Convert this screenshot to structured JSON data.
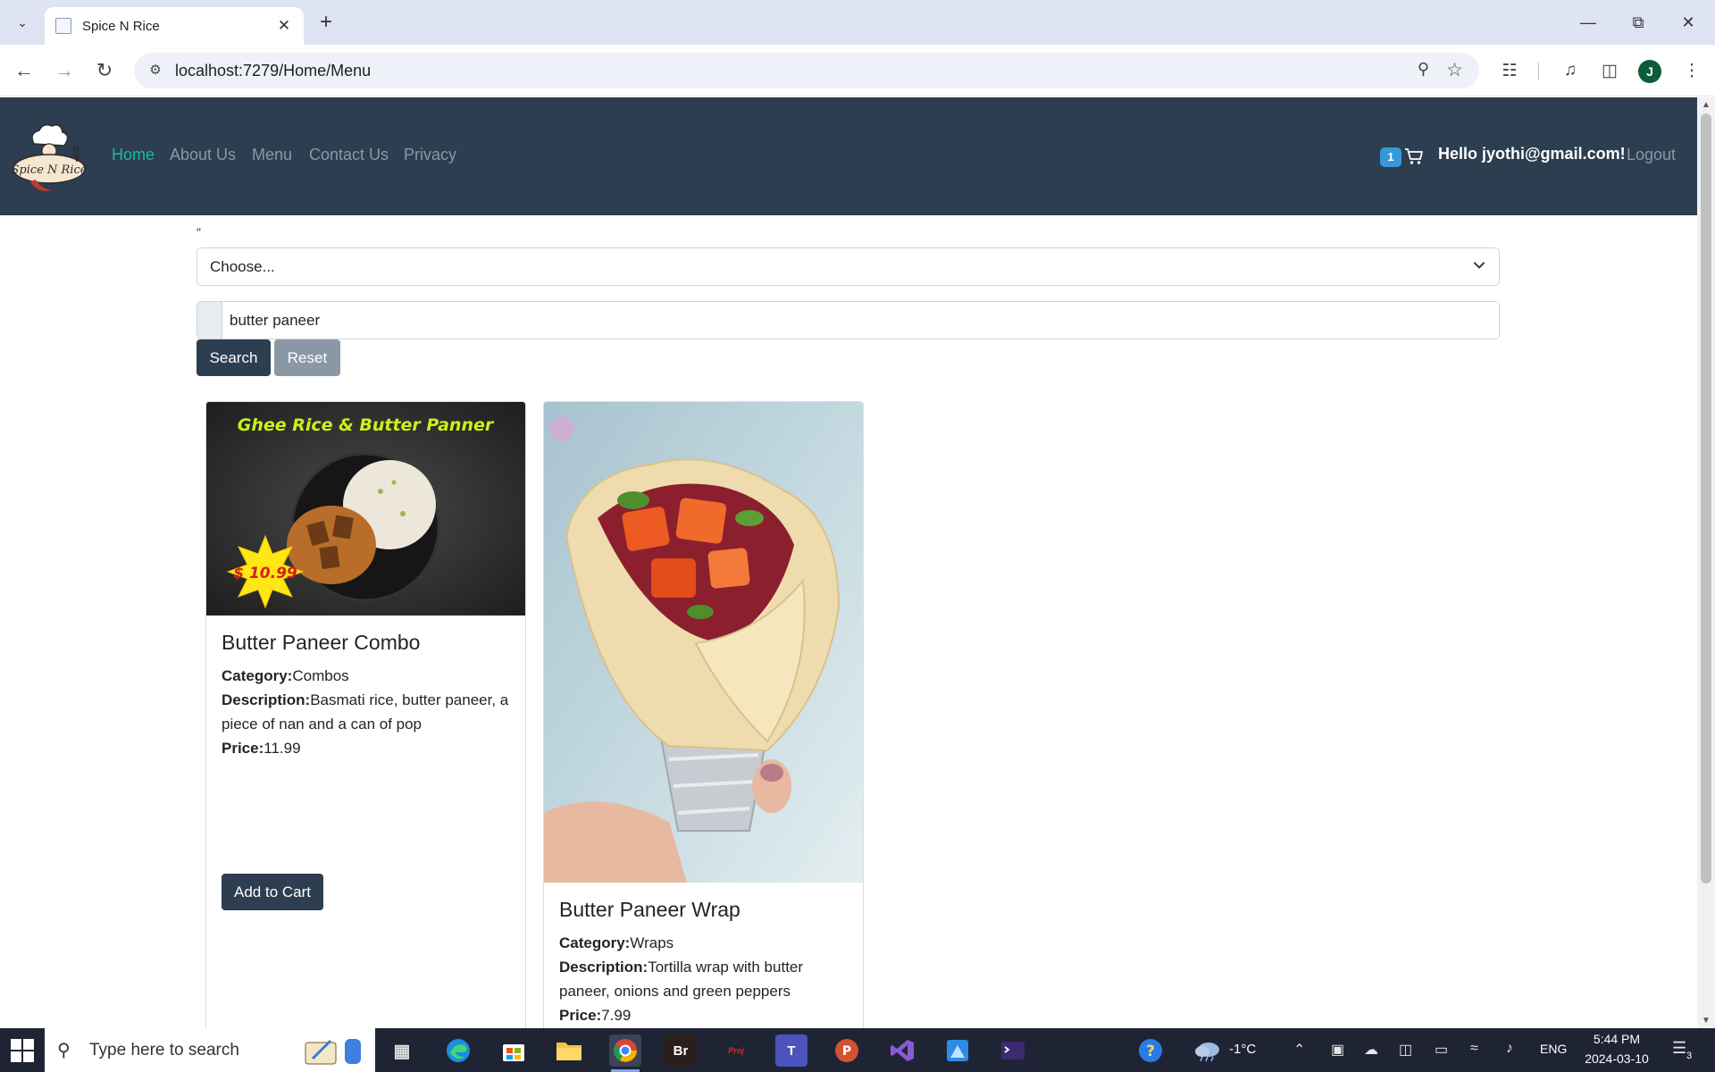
{
  "browser": {
    "tab_title": "Spice N Rice",
    "url": "localhost:7279/Home/Menu",
    "profile_initial": "J"
  },
  "site": {
    "logo_text": "Spice N Rice",
    "nav": [
      "Home",
      "About Us",
      "Menu",
      "Contact Us",
      "Privacy"
    ],
    "active_nav": "Home",
    "cart_count": "1",
    "greeting": "Hello jyothi@gmail.com!",
    "logout": "Logout",
    "colors": {
      "navbar": "#2c3e50",
      "active_link": "#18bc9c",
      "badge": "#3498db",
      "muted_link": "#8a98a8"
    }
  },
  "filter": {
    "stray_text": "\"",
    "category_select": "Choose...",
    "search_value": "butter paneer",
    "search_button": "Search",
    "reset_button": "Reset"
  },
  "products": [
    {
      "title": "Butter Paneer Combo",
      "category_label": "Category:",
      "category": "Combos",
      "description_label": "Description:",
      "description": "Basmati rice, butter paneer, a piece of nan and a can of pop",
      "price_label": "Price:",
      "price": "11.99",
      "add_to_cart": "Add to Cart",
      "image_banner": "Ghee Rice & Butter Panner",
      "image_price_badge": "$ 10.99"
    },
    {
      "title": "Butter Paneer Wrap",
      "category_label": "Category:",
      "category": "Wraps",
      "description_label": "Description:",
      "description": "Tortilla wrap with butter paneer, onions and green peppers",
      "price_label": "Price:",
      "price": "7.99"
    }
  ],
  "taskbar": {
    "search_placeholder": "Type here to search",
    "weather": "-1°C",
    "language": "ENG",
    "time": "5:44 PM",
    "date": "2024-03-10",
    "notification_count": "3"
  }
}
